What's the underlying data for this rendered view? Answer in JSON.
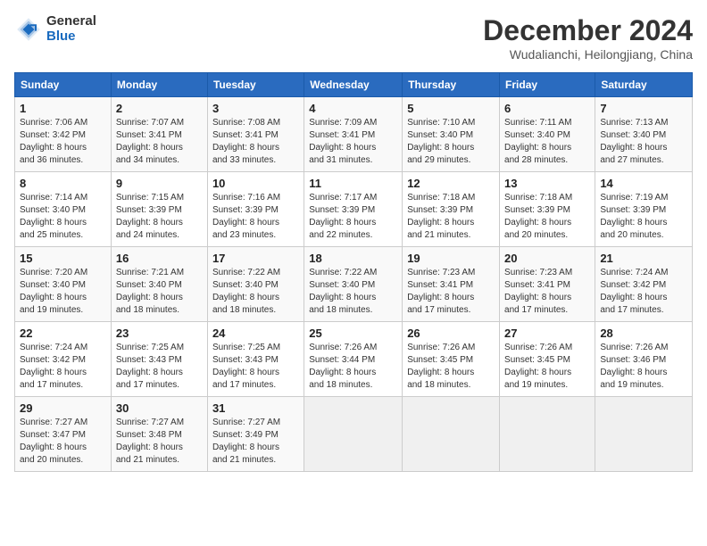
{
  "logo": {
    "general": "General",
    "blue": "Blue"
  },
  "header": {
    "month": "December 2024",
    "location": "Wudalianchi, Heilongjiang, China"
  },
  "weekdays": [
    "Sunday",
    "Monday",
    "Tuesday",
    "Wednesday",
    "Thursday",
    "Friday",
    "Saturday"
  ],
  "weeks": [
    [
      {
        "day": "1",
        "info": "Sunrise: 7:06 AM\nSunset: 3:42 PM\nDaylight: 8 hours\nand 36 minutes."
      },
      {
        "day": "2",
        "info": "Sunrise: 7:07 AM\nSunset: 3:41 PM\nDaylight: 8 hours\nand 34 minutes."
      },
      {
        "day": "3",
        "info": "Sunrise: 7:08 AM\nSunset: 3:41 PM\nDaylight: 8 hours\nand 33 minutes."
      },
      {
        "day": "4",
        "info": "Sunrise: 7:09 AM\nSunset: 3:41 PM\nDaylight: 8 hours\nand 31 minutes."
      },
      {
        "day": "5",
        "info": "Sunrise: 7:10 AM\nSunset: 3:40 PM\nDaylight: 8 hours\nand 29 minutes."
      },
      {
        "day": "6",
        "info": "Sunrise: 7:11 AM\nSunset: 3:40 PM\nDaylight: 8 hours\nand 28 minutes."
      },
      {
        "day": "7",
        "info": "Sunrise: 7:13 AM\nSunset: 3:40 PM\nDaylight: 8 hours\nand 27 minutes."
      }
    ],
    [
      {
        "day": "8",
        "info": "Sunrise: 7:14 AM\nSunset: 3:40 PM\nDaylight: 8 hours\nand 25 minutes."
      },
      {
        "day": "9",
        "info": "Sunrise: 7:15 AM\nSunset: 3:39 PM\nDaylight: 8 hours\nand 24 minutes."
      },
      {
        "day": "10",
        "info": "Sunrise: 7:16 AM\nSunset: 3:39 PM\nDaylight: 8 hours\nand 23 minutes."
      },
      {
        "day": "11",
        "info": "Sunrise: 7:17 AM\nSunset: 3:39 PM\nDaylight: 8 hours\nand 22 minutes."
      },
      {
        "day": "12",
        "info": "Sunrise: 7:18 AM\nSunset: 3:39 PM\nDaylight: 8 hours\nand 21 minutes."
      },
      {
        "day": "13",
        "info": "Sunrise: 7:18 AM\nSunset: 3:39 PM\nDaylight: 8 hours\nand 20 minutes."
      },
      {
        "day": "14",
        "info": "Sunrise: 7:19 AM\nSunset: 3:39 PM\nDaylight: 8 hours\nand 20 minutes."
      }
    ],
    [
      {
        "day": "15",
        "info": "Sunrise: 7:20 AM\nSunset: 3:40 PM\nDaylight: 8 hours\nand 19 minutes."
      },
      {
        "day": "16",
        "info": "Sunrise: 7:21 AM\nSunset: 3:40 PM\nDaylight: 8 hours\nand 18 minutes."
      },
      {
        "day": "17",
        "info": "Sunrise: 7:22 AM\nSunset: 3:40 PM\nDaylight: 8 hours\nand 18 minutes."
      },
      {
        "day": "18",
        "info": "Sunrise: 7:22 AM\nSunset: 3:40 PM\nDaylight: 8 hours\nand 18 minutes."
      },
      {
        "day": "19",
        "info": "Sunrise: 7:23 AM\nSunset: 3:41 PM\nDaylight: 8 hours\nand 17 minutes."
      },
      {
        "day": "20",
        "info": "Sunrise: 7:23 AM\nSunset: 3:41 PM\nDaylight: 8 hours\nand 17 minutes."
      },
      {
        "day": "21",
        "info": "Sunrise: 7:24 AM\nSunset: 3:42 PM\nDaylight: 8 hours\nand 17 minutes."
      }
    ],
    [
      {
        "day": "22",
        "info": "Sunrise: 7:24 AM\nSunset: 3:42 PM\nDaylight: 8 hours\nand 17 minutes."
      },
      {
        "day": "23",
        "info": "Sunrise: 7:25 AM\nSunset: 3:43 PM\nDaylight: 8 hours\nand 17 minutes."
      },
      {
        "day": "24",
        "info": "Sunrise: 7:25 AM\nSunset: 3:43 PM\nDaylight: 8 hours\nand 17 minutes."
      },
      {
        "day": "25",
        "info": "Sunrise: 7:26 AM\nSunset: 3:44 PM\nDaylight: 8 hours\nand 18 minutes."
      },
      {
        "day": "26",
        "info": "Sunrise: 7:26 AM\nSunset: 3:45 PM\nDaylight: 8 hours\nand 18 minutes."
      },
      {
        "day": "27",
        "info": "Sunrise: 7:26 AM\nSunset: 3:45 PM\nDaylight: 8 hours\nand 19 minutes."
      },
      {
        "day": "28",
        "info": "Sunrise: 7:26 AM\nSunset: 3:46 PM\nDaylight: 8 hours\nand 19 minutes."
      }
    ],
    [
      {
        "day": "29",
        "info": "Sunrise: 7:27 AM\nSunset: 3:47 PM\nDaylight: 8 hours\nand 20 minutes."
      },
      {
        "day": "30",
        "info": "Sunrise: 7:27 AM\nSunset: 3:48 PM\nDaylight: 8 hours\nand 21 minutes."
      },
      {
        "day": "31",
        "info": "Sunrise: 7:27 AM\nSunset: 3:49 PM\nDaylight: 8 hours\nand 21 minutes."
      },
      null,
      null,
      null,
      null
    ]
  ]
}
